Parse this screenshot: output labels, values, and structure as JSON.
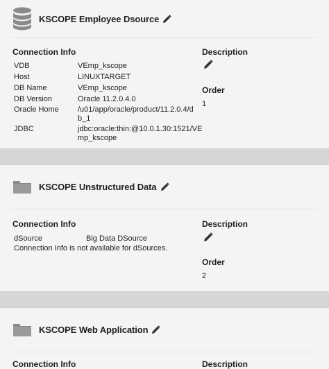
{
  "sources": [
    {
      "name": "KSCOPE Employee Dsource",
      "icon": "database-icon",
      "connection_info_label": "Connection Info",
      "rows": [
        {
          "key": "VDB",
          "value": "VEmp_kscope"
        },
        {
          "key": "Host",
          "value": "LINUXTARGET"
        },
        {
          "key": "DB Name",
          "value": "VEmp_kscope"
        },
        {
          "key": "DB Version",
          "value": "Oracle 11.2.0.4.0"
        },
        {
          "key": "Oracle Home",
          "value_lines": [
            "/u01/app/oracle/product/11.2.0.4/d",
            "b_1"
          ]
        },
        {
          "key": "JDBC",
          "value_lines": [
            "jdbc:oracle:thin:@10.0.1.30:1521/VE",
            "mp_kscope"
          ]
        }
      ],
      "description_label": "Description",
      "order_label": "Order",
      "order_value": "1"
    },
    {
      "name": "KSCOPE Unstructured Data",
      "icon": "folder-icon",
      "connection_info_label": "Connection Info",
      "rows": [
        {
          "key": "dSource",
          "value": "Big Data DSource"
        }
      ],
      "note": "Connection Info is not available for dSources.",
      "description_label": "Description",
      "order_label": "Order",
      "order_value": "2"
    },
    {
      "name": "KSCOPE Web Application",
      "icon": "folder-icon",
      "connection_info_label": "Connection Info",
      "description_label": "Description"
    }
  ],
  "colors": {
    "card_background": "#f4f4f4",
    "page_background": "#d9d9d9",
    "icon_gray": "#8a8a8a",
    "text": "#1f1f1f"
  }
}
